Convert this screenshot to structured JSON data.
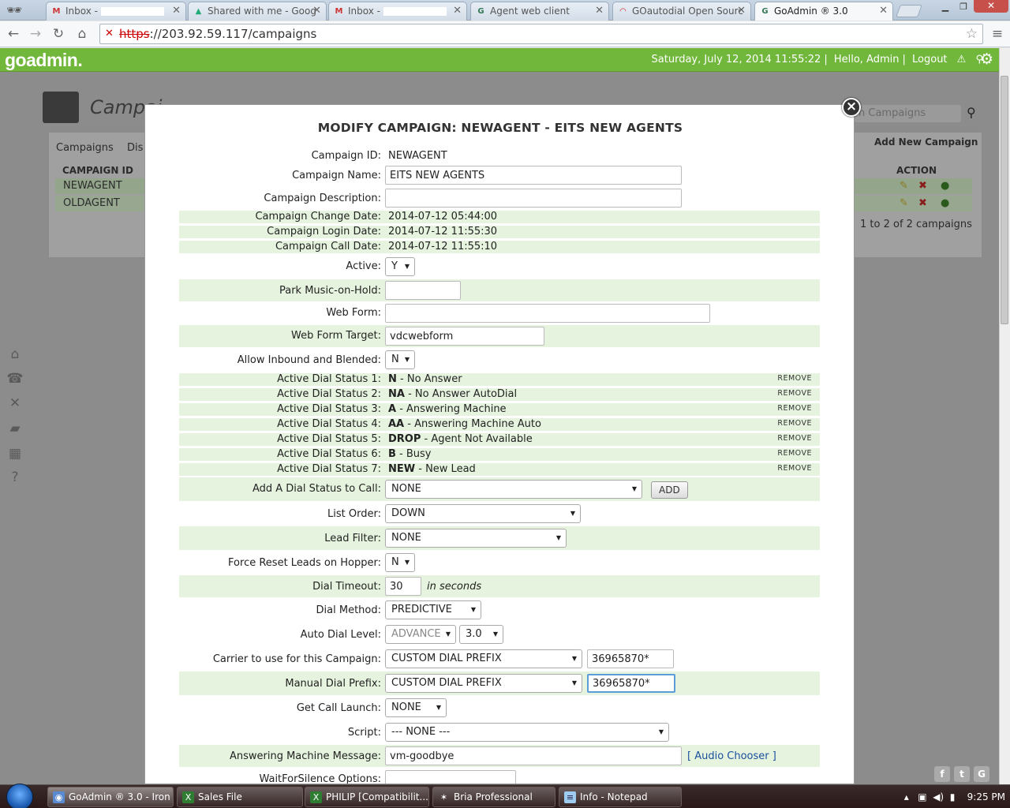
{
  "browser": {
    "tabs": [
      {
        "label": "Inbox -",
        "icon": "gmail-icon"
      },
      {
        "label": "Shared with me - Goog",
        "icon": "google-drive-icon"
      },
      {
        "label": "Inbox -",
        "icon": "gmail-icon"
      },
      {
        "label": "Agent web client",
        "icon": "goautodial-icon"
      },
      {
        "label": "GOautodial Open Sourc",
        "icon": "goautodial-red-icon"
      },
      {
        "label": "GoAdmin ® 3.0",
        "icon": "goadmin-icon"
      }
    ],
    "url_scheme": "https",
    "url_rest": "://203.92.59.117/campaigns"
  },
  "header": {
    "logo": "goadmin.",
    "datetime": "Saturday, July 12, 2014 11:55:22",
    "greeting": "Hello, Admin",
    "logout": "Logout"
  },
  "background": {
    "page_title": "Campai",
    "search_placeholder": "h Campaigns",
    "tab_campaigns": "Campaigns",
    "tab_dis": "Dis",
    "add_new": "Add New Campaign",
    "col_id": "CAMPAIGN ID",
    "col_action": "ACTION",
    "rows": [
      "NEWAGENT",
      "OLDAGENT"
    ],
    "pager": "1 to 2 of 2 campaigns"
  },
  "modal": {
    "title": "MODIFY CAMPAIGN: NEWAGENT - EITS NEW AGENTS",
    "campaign_id_label": "Campaign ID:",
    "campaign_id": "NEWAGENT",
    "campaign_name_label": "Campaign Name:",
    "campaign_name": "EITS NEW AGENTS",
    "campaign_desc_label": "Campaign Description:",
    "campaign_desc": "",
    "change_date_label": "Campaign Change Date:",
    "change_date": "2014-07-12 05:44:00",
    "login_date_label": "Campaign Login Date:",
    "login_date": "2014-07-12 11:55:30",
    "call_date_label": "Campaign Call Date:",
    "call_date": "2014-07-12 11:55:10",
    "active_label": "Active:",
    "active": "Y",
    "park_label": "Park Music-on-Hold:",
    "park": "",
    "webform_label": "Web Form:",
    "webform": "",
    "webform_target_label": "Web Form Target:",
    "webform_target": "vdcwebform",
    "inbound_label": "Allow Inbound and Blended:",
    "inbound": "N",
    "dial_statuses": [
      {
        "label": "Active Dial Status 1:",
        "code": "N",
        "desc": " - No Answer"
      },
      {
        "label": "Active Dial Status 2:",
        "code": "NA",
        "desc": " - No Answer AutoDial"
      },
      {
        "label": "Active Dial Status 3:",
        "code": "A",
        "desc": " - Answering Machine"
      },
      {
        "label": "Active Dial Status 4:",
        "code": "AA",
        "desc": " - Answering Machine Auto"
      },
      {
        "label": "Active Dial Status 5:",
        "code": "DROP",
        "desc": " - Agent Not Available"
      },
      {
        "label": "Active Dial Status 6:",
        "code": "B",
        "desc": " - Busy"
      },
      {
        "label": "Active Dial Status 7:",
        "code": "NEW",
        "desc": " - New Lead"
      }
    ],
    "remove_label": "REMOVE",
    "add_status_label": "Add A Dial Status to Call:",
    "add_status": "NONE",
    "add_button": "ADD",
    "list_order_label": "List Order:",
    "list_order": "DOWN",
    "lead_filter_label": "Lead Filter:",
    "lead_filter": "NONE",
    "force_reset_label": "Force Reset Leads on Hopper:",
    "force_reset": "N",
    "dial_timeout_label": "Dial Timeout:",
    "dial_timeout": "30",
    "dial_timeout_unit": "in seconds",
    "dial_method_label": "Dial Method:",
    "dial_method": "PREDICTIVE",
    "auto_dial_label": "Auto Dial Level:",
    "auto_dial_mode": "ADVANCE",
    "auto_dial_level": "3.0",
    "carrier_label": "Carrier to use for this Campaign:",
    "carrier": "CUSTOM DIAL PREFIX",
    "carrier_prefix": "36965870*",
    "manual_prefix_label": "Manual Dial Prefix:",
    "manual_prefix": "CUSTOM DIAL PREFIX",
    "manual_prefix_value": "36965870*",
    "call_launch_label": "Get Call Launch:",
    "call_launch": "NONE",
    "script_label": "Script:",
    "script": "--- NONE ---",
    "am_message_label": "Answering Machine Message:",
    "am_message": "vm-goodbye",
    "audio_chooser": "[ Audio Chooser ]",
    "waitforsilence_label": "WaitForSilence Options:"
  },
  "taskbar": {
    "items": [
      "GoAdmin ® 3.0 - Iron",
      "Sales File",
      "PHILIP  [Compatibilit...",
      "Bria Professional",
      "Info - Notepad"
    ],
    "clock": "9:25 PM"
  },
  "colors": {
    "header_green": "#71b73c",
    "row_shade": "#e6f4df",
    "link_blue": "#1a4f9c"
  }
}
